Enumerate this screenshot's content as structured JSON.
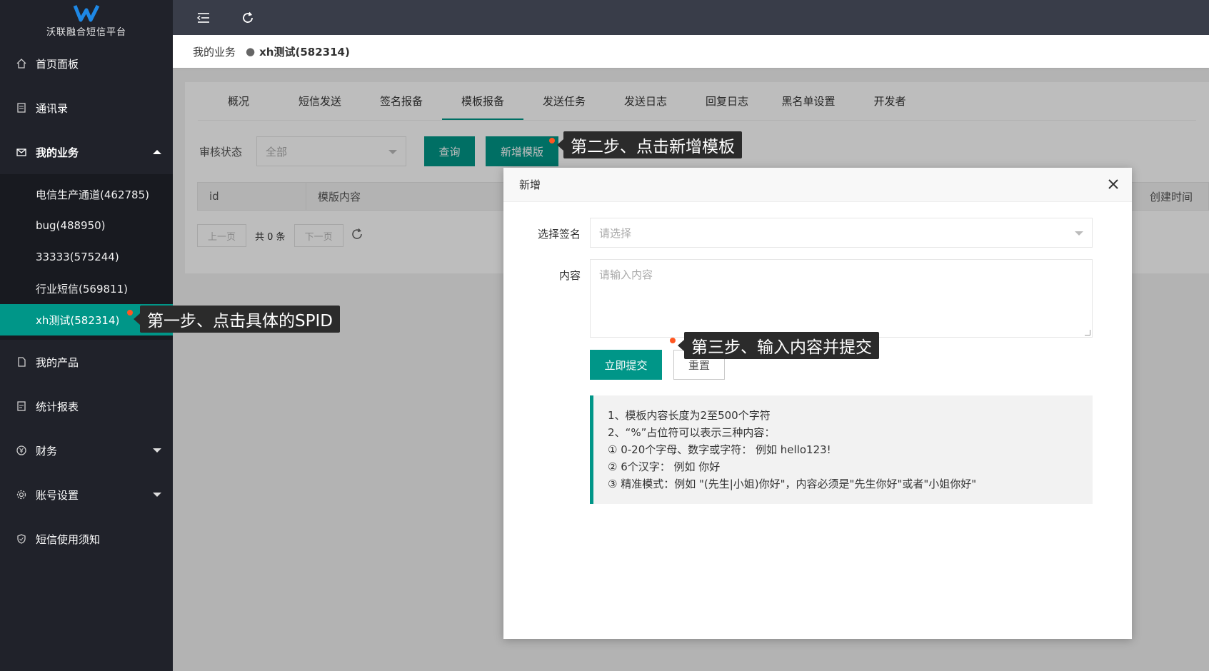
{
  "app": {
    "logo_text": "沃联融合短信平台"
  },
  "sidebar": {
    "items": [
      {
        "label": "首页面板",
        "icon": "home-icon"
      },
      {
        "label": "通讯录",
        "icon": "contacts-icon"
      },
      {
        "label": "我的业务",
        "icon": "mail-icon"
      },
      {
        "label": "我的产品",
        "icon": "product-icon"
      },
      {
        "label": "统计报表",
        "icon": "report-icon"
      },
      {
        "label": "财务",
        "icon": "finance-icon"
      },
      {
        "label": "账号设置",
        "icon": "gear-icon"
      },
      {
        "label": "短信使用须知",
        "icon": "shield-icon"
      }
    ],
    "sub_items": [
      {
        "label": "电信生产通道(462785)"
      },
      {
        "label": "bug(488950)"
      },
      {
        "label": "33333(575244)"
      },
      {
        "label": "行业短信(569811)"
      },
      {
        "label": "xh测试(582314)"
      }
    ]
  },
  "breadcrumb": {
    "root": "我的业务",
    "separator": "●",
    "current": "xh测试(582314)"
  },
  "tabs": [
    {
      "label": "概况"
    },
    {
      "label": "短信发送"
    },
    {
      "label": "签名报备"
    },
    {
      "label": "模板报备"
    },
    {
      "label": "发送任务"
    },
    {
      "label": "发送日志"
    },
    {
      "label": "回复日志"
    },
    {
      "label": "黑名单设置"
    },
    {
      "label": "开发者"
    }
  ],
  "filter": {
    "status_label": "审核状态",
    "status_value": "全部",
    "query_button": "查询",
    "add_button": "新增模版"
  },
  "table": {
    "col_id": "id",
    "col_content": "模版内容",
    "col_created": "创建时间"
  },
  "pager": {
    "prev": "上一页",
    "total": "共 0 条",
    "next": "下一页"
  },
  "modal": {
    "title": "新增",
    "signature_label": "选择签名",
    "signature_placeholder": "请选择",
    "content_label": "内容",
    "content_placeholder": "请输入内容",
    "submit": "立即提交",
    "reset": "重置",
    "tips": [
      "1、模板内容长度为2至500个字符",
      "2、“%”占位符可以表示三种内容：",
      "① 0-20个字母、数字或字符： 例如 hello123!",
      "② 6个汉字： 例如 你好",
      "③ 精准模式：例如 \"(先生|小姐)你好\"，内容必须是\"先生你好\"或者\"小姐你好\""
    ]
  },
  "annotations": {
    "step1": "第一步、点击具体的SPID",
    "step2": "第二步、点击新增模板",
    "step3": "第三步、输入内容并提交"
  },
  "colors": {
    "accent": "#009688",
    "sidebar_bg": "#20222a",
    "header_bg": "#393d49",
    "dot": "#ff5722"
  }
}
